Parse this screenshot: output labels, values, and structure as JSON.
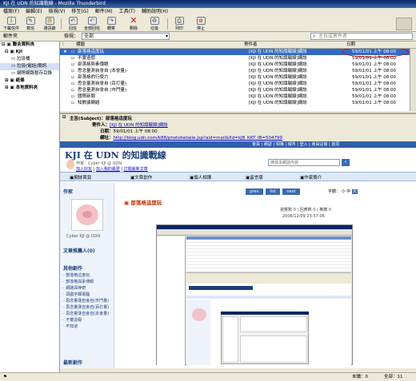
{
  "window": {
    "title": "KJI 在 UDN 的知識戰線 - Mozilla Thunderbird"
  },
  "menu": [
    "檔案(F)",
    "編輯(E)",
    "檢視(V)",
    "移至(G)",
    "郵件(M)",
    "工具(T)",
    "輔助說明(H)"
  ],
  "toolbar": [
    {
      "label": "下載信件",
      "icon": "download-icon"
    },
    {
      "label": "寫信",
      "icon": "compose-icon"
    },
    {
      "label": "通訊錄",
      "icon": "address-book-icon"
    },
    {
      "label": "回信",
      "icon": "reply-icon"
    },
    {
      "label": "全部回信",
      "icon": "reply-all-icon"
    },
    {
      "label": "轉寄",
      "icon": "forward-icon"
    },
    {
      "label": "刪除",
      "icon": "delete-icon"
    },
    {
      "label": "垃圾",
      "icon": "junk-icon"
    },
    {
      "label": "列印",
      "icon": "print-icon"
    },
    {
      "label": "停止",
      "icon": "stop-icon"
    }
  ],
  "subbar": {
    "folders_label": "郵件夾",
    "view_label": "檢視：",
    "view_value": "全部",
    "search_placeholder": "主旨或寄件者"
  },
  "folders": [
    "聯合資料夾",
    "KJI",
    "垃圾桶",
    "垃圾(電話)簡訊",
    "網際網路暫存目錄",
    "紙條",
    "本地資料夾"
  ],
  "columns": {
    "subject": "標題",
    "sender": "寄件者",
    "date": "日期"
  },
  "messages": [
    {
      "subject": "部落格這度玩",
      "sender": "[KJI 在 UDN 的知識戰線]網誌",
      "date": "59/01/01 上午 08:00"
    },
    {
      "subject": "不實造假",
      "sender": "[KJI 在 UDN 的知識戰線]網誌",
      "date": "59/01/01 上午 08:00"
    },
    {
      "subject": "部落格與素傳眼",
      "sender": "[KJI 在 UDN 的知識戰線]網誌",
      "date": "59/01/01 上午 08:00"
    },
    {
      "subject": "思念量測自會自 (本會量)",
      "sender": "[KJI 在 UDN 的知識戰線]網誌",
      "date": "59/01/01 上午 08:00"
    },
    {
      "subject": "部落格的行使力",
      "sender": "[KJI 在 UDN 的知識戰線]網誌",
      "date": "59/01/01 上午 08:00"
    },
    {
      "subject": "思念量測自會自 (百打量)",
      "sender": "[KJI 在 UDN 的知識戰線]網誌",
      "date": "59/01/01 上午 08:00"
    },
    {
      "subject": "思念量測自會自 (市門量)",
      "sender": "[KJI 在 UDN 的知識戰線]網誌",
      "date": "59/01/01 上午 08:00"
    },
    {
      "subject": "國際新聞",
      "sender": "[KJI 在 UDN 的知識戰線]網誌",
      "date": "59/01/01 上午 08:00"
    },
    {
      "subject": "知數據網絡",
      "sender": "[KJI 在 UDN 的知識戰線]網誌",
      "date": "59/01/01 上午 08:00"
    }
  ],
  "preview": {
    "subject_label": "主旨(Subject)：",
    "subject": "部落格這度玩",
    "from_label": "寄件人：",
    "from": "[KJI 在 UDN 的知識戰線]網誌",
    "date_label": "日期：",
    "date": "59/01/01 上午 08:00",
    "link_label": "網址：",
    "link": "http://blog.udn.com/k88/photohetaile.jsp?aid=mail&fid=kJB_KKT_IB=504799"
  },
  "blog": {
    "title": "KJI 在 UDN 的知識戰線",
    "author_line": "作家：Cyber KJI @ UDN",
    "add_friend": "加入好友",
    "add_note": "加入我的最愛",
    "rss": "訂閱最新文章",
    "topnav": [
      "會員",
      "網誌",
      "相簿",
      "城市",
      "登入",
      "會員註冊",
      "首頁"
    ],
    "search_placeholder": "搜尋本網誌內容",
    "tabs": [
      "網誌首頁",
      "文章創作",
      "個人相簿",
      "留言版",
      "作家簡介"
    ],
    "sidebar": {
      "author_title": "作家",
      "author_name": "Cyber KJI @ UDN",
      "fans_title": "文章推薦人",
      "fans_count": "(0)",
      "other_title": "其他創作",
      "other_links": [
        "部落格這度玩",
        "部落格與素傳眼",
        "網路與神奇",
        "頭戲字細電腦",
        "思念量測自會自(市門量)",
        "思念量測自會自(百打量)",
        "思念量測自會自(本會量)",
        "不實造假",
        "不知道"
      ],
      "latest_title": "最新創作"
    },
    "pager": {
      "prev": "prev",
      "list": "list",
      "next": "next",
      "font_label": "字體：",
      "font_sizes": [
        "小",
        "中",
        "大"
      ]
    },
    "article": {
      "title": "部落格這度玩",
      "meta": "瀏覽數 0 | 回應數 0 | 推薦 0",
      "timestamp": "2006/12/09 23:57:06"
    }
  },
  "status": {
    "unread_label": "未讀：",
    "unread": "0",
    "total_label": "全部：",
    "total": "11"
  },
  "colors": {
    "selection": "#316ac5",
    "annotation": "#e00000",
    "link": "#0000cc"
  }
}
